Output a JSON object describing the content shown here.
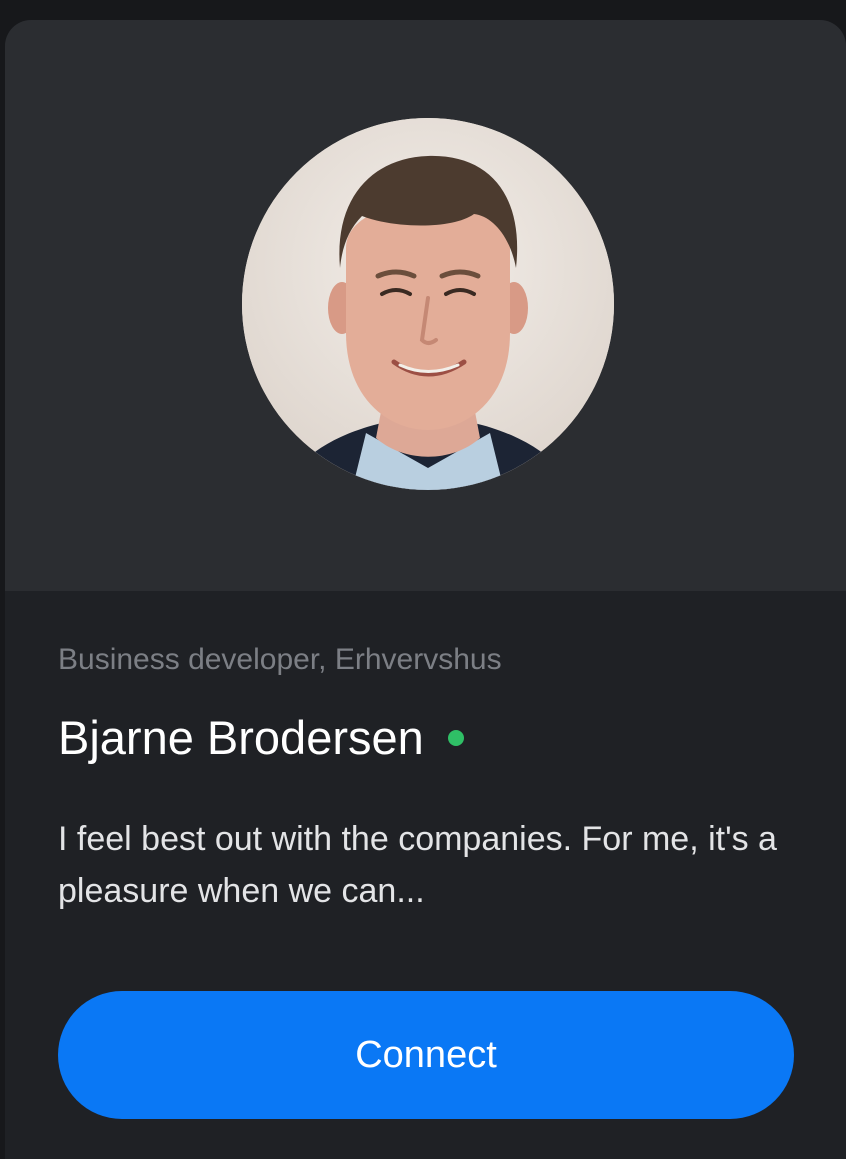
{
  "profile": {
    "role": "Business developer, Erhvervshus",
    "name": "Bjarne Brodersen",
    "online": true,
    "bio": "I feel best out with the companies. For me, it's a pleasure when we can...",
    "connect_label": "Connect"
  },
  "colors": {
    "card_top": "#2b2d31",
    "card_body": "#1f2125",
    "status_online": "#2fbf66",
    "accent": "#0a78f5"
  }
}
